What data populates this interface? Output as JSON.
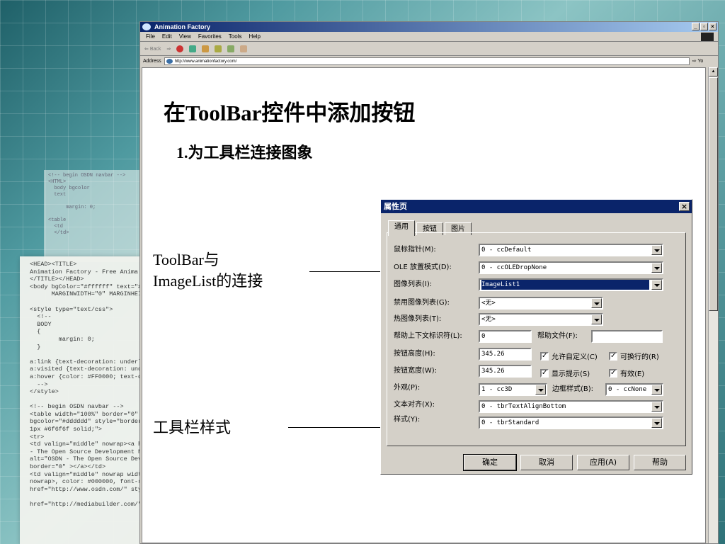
{
  "slide": {
    "title": "在ToolBar控件中添加按钮",
    "subtitle": "1.为工具栏连接图象",
    "callout_1_line1": "ToolBar与",
    "callout_1_line2": "ImageList的连接",
    "callout_2": "工具栏样式"
  },
  "browser": {
    "title": "Animation Factory",
    "menu": [
      "File",
      "Edit",
      "View",
      "Favorites",
      "Tools",
      "Help"
    ],
    "back_label": "Back",
    "address_label": "Address",
    "url": "http://www.animationfactory.com/",
    "go_label": "Yo"
  },
  "background_code": {
    "main": "<HEAD><TITLE>\nAnimation Factory - Free Anima\n</TITLE></HEAD>\n<body bgColor=\"#ffffff\" text=\"#000000\" bgcolor\n      MARGINWIDTH=\"0\" MARGINHEIGHT=\"0\">\n\n<style type=\"text/css\">\n  <!--\n  BODY\n  {\n        margin: 0;\n  }\n\na:link {text-decoration: underline}\na:visited {text-decoration: underline}\na:hover {color: #FF0000; text-decoration: none}\n  -->\n</style>\n\n<!-- begin OSDN navbar -->\n<table width=\"100%\" border=\"0\" cellpad\nbgcolor=\"#dddddd\" style=\"border-bottom\n1px #6f6f6f solid;\">\n<tr>\n<td valign=\"middle\" nowrap><a href=\"http\n- The Open Source Development Network\nalt=\"OSDN - The Open Source Development\nborder=\"0\" ></a></td>\n<td valign=\"middle\" nowrap width=\"100%\"\nnowrap>, color: #000000, font-size\nhref=\"http://www.osdn.com/\" style\n\nhref=\"http://mediabuilder.com/\" style=\"co",
    "small": "<!-- begin OSDN navbar -->\n<HTML>\n  body bgcolor\n  text\n\n      margin: 0;\n\n<table\n  <td\n  </td>"
  },
  "dialog": {
    "title": "属性页",
    "close_label": "×",
    "tabs": [
      "通用",
      "按钮",
      "图片"
    ],
    "fields": {
      "mouse_pointer_label": "鼠标指针(M):",
      "mouse_pointer_value": "0 - ccDefault",
      "ole_drop_label": "OLE 放置模式(D):",
      "ole_drop_value": "0 - ccOLEDropNone",
      "image_list_label": "图像列表(I):",
      "image_list_value": "ImageList1",
      "disabled_image_list_label": "禁用图像列表(G):",
      "disabled_image_list_value": "<无>",
      "hot_image_list_label": "热图像列表(T):",
      "hot_image_list_value": "<无>",
      "help_context_label": "帮助上下文标识符(L):",
      "help_context_value": "0",
      "help_file_label": "帮助文件(F):",
      "help_file_value": "",
      "button_height_label": "按钮高度(H):",
      "button_height_value": "345.26",
      "button_width_label": "按钮宽度(W):",
      "button_width_value": "345.26",
      "appearance_label": "外观(P):",
      "appearance_value": "1 - cc3D",
      "border_style_label": "边框样式(B):",
      "border_style_value": "0 - ccNone",
      "text_align_label": "文本对齐(X):",
      "text_align_value": "0 - tbrTextAlignBottom",
      "style_label": "样式(Y):",
      "style_value": "0 - tbrStandard"
    },
    "checkboxes": {
      "allow_customize": "允许自定义(C)",
      "wrappable": "可换行的(R)",
      "show_tips": "显示提示(S)",
      "enabled": "有效(E)"
    },
    "buttons": {
      "ok": "确定",
      "cancel": "取消",
      "apply": "应用(A)",
      "help": "帮助"
    }
  }
}
